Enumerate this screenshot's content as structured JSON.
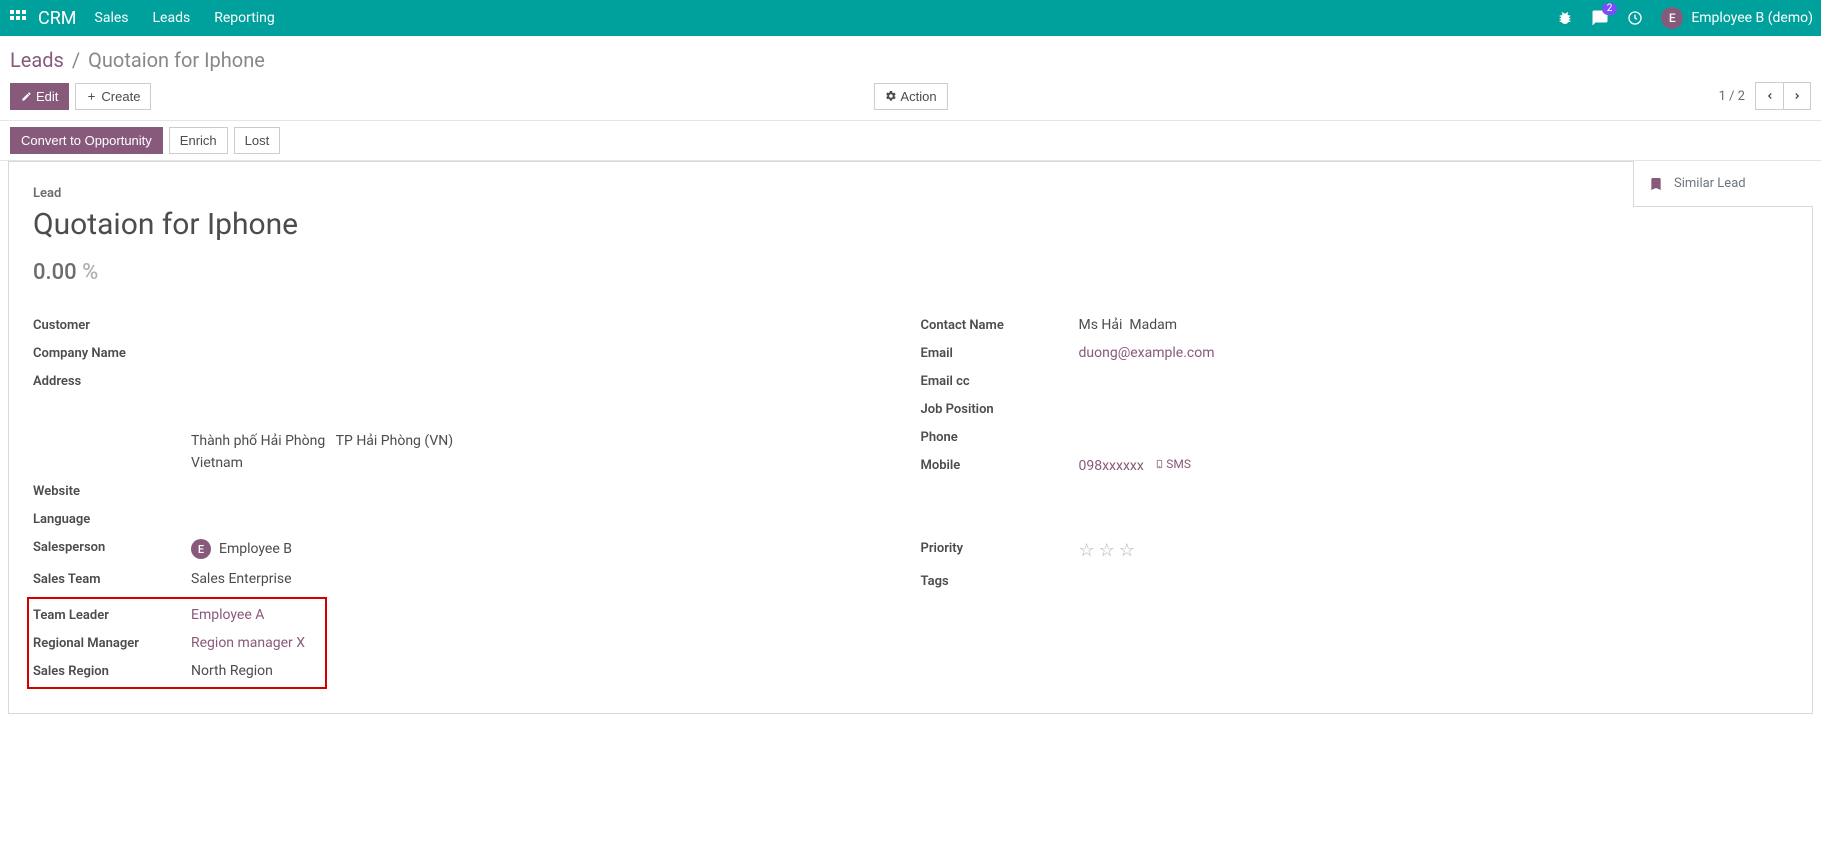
{
  "topbar": {
    "brand": "CRM",
    "menu": [
      "Sales",
      "Leads",
      "Reporting"
    ],
    "msg_badge": "2",
    "user_initial": "E",
    "user_name": "Employee B (demo)"
  },
  "breadcrumbs": {
    "root": "Leads",
    "current": "Quotaion for Iphone"
  },
  "buttons": {
    "edit": "Edit",
    "create": "Create",
    "action": "Action",
    "convert": "Convert to Opportunity",
    "enrich": "Enrich",
    "lost": "Lost"
  },
  "pager": "1 / 2",
  "stat": {
    "similar": "Similar Lead"
  },
  "record": {
    "type": "Lead",
    "title": "Quotaion for Iphone",
    "probability": "0.00",
    "pct": "%"
  },
  "labels": {
    "customer": "Customer",
    "company_name": "Company Name",
    "address": "Address",
    "website": "Website",
    "language": "Language",
    "salesperson": "Salesperson",
    "sales_team": "Sales Team",
    "team_leader": "Team Leader",
    "regional_manager": "Regional Manager",
    "sales_region": "Sales Region",
    "contact_name": "Contact Name",
    "email": "Email",
    "email_cc": "Email cc",
    "job_position": "Job Position",
    "phone": "Phone",
    "mobile": "Mobile",
    "priority": "Priority",
    "tags": "Tags"
  },
  "values": {
    "address_city": "Thành phố Hải Phòng",
    "address_state": "TP Hải Phòng (VN)",
    "address_country": "Vietnam",
    "salesperson_initial": "E",
    "salesperson": "Employee B",
    "sales_team": "Sales Enterprise",
    "team_leader": "Employee A",
    "regional_manager": "Region manager X",
    "sales_region": "North Region",
    "contact_name": "Ms Hải",
    "contact_title": "Madam",
    "email": "duong@example.com",
    "mobile": "098xxxxxx",
    "sms": "SMS"
  }
}
